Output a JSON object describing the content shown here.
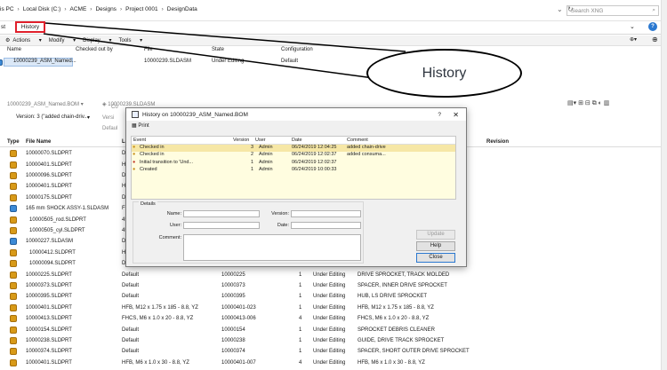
{
  "address": {
    "crumbs": [
      "is PC",
      "Local Disk (C:)",
      "ACME",
      "Designs",
      "Project 0001",
      "DesignData"
    ],
    "search_placeholder": "Search XNG"
  },
  "ribbon": {
    "left_stub": "st",
    "history_tab": "History"
  },
  "toolbar": {
    "actions": "Actions",
    "modify": "Modify",
    "display": "Display",
    "tools": "Tools"
  },
  "upper": {
    "headers": [
      "Name",
      "Checked out by",
      "File",
      "State",
      "Configuration"
    ],
    "row": {
      "name": "10000239_ASM_Named...",
      "checked_out_by": "",
      "file": "10000239.SLDASM",
      "state": "Under Editing",
      "configuration": "Default"
    }
  },
  "callout": {
    "text": "History"
  },
  "mid": {
    "tab1": "10000239_ASM_Named.BOM",
    "tab2": "10000239.SLDASM",
    "version_label": "Version: 3 (\"added chain-driv...",
    "versions_stub": "Versi",
    "default_stub": "Defaul",
    "con_stub": "Co"
  },
  "grid": {
    "headers": {
      "type": "Type",
      "file_name": "File Name",
      "revision": "Revision",
      "loc": "Loc"
    },
    "rows": [
      {
        "file": "10000070.SLDPRT",
        "config": "Def",
        "part": "",
        "ver": "",
        "state": "",
        "desc": ""
      },
      {
        "file": "10000401.SLDPRT",
        "config": "HFB",
        "part": "",
        "ver": "",
        "state": "",
        "desc": ""
      },
      {
        "file": "10000096.SLDPRT",
        "config": "Def",
        "part": "",
        "ver": "",
        "state": "",
        "desc": ""
      },
      {
        "file": "10000401.SLDPRT",
        "config": "HFB",
        "part": "",
        "ver": "",
        "state": "",
        "desc": ""
      },
      {
        "file": "10000175.SLDPRT",
        "config": "Def",
        "part": "",
        "ver": "",
        "state": "",
        "desc": ""
      },
      {
        "file": "165 mm SHOCK ASSY-1.SLDASM",
        "config": "Fre",
        "part": "",
        "ver": "",
        "state": "",
        "desc": "",
        "asm": true
      },
      {
        "file": "10000505_rod.SLDPRT",
        "config": "45n",
        "part": "",
        "ver": "",
        "state": "",
        "desc": ""
      },
      {
        "file": "10000505_cyl.SLDPRT",
        "config": "45n",
        "part": "",
        "ver": "",
        "state": "",
        "desc": ""
      },
      {
        "file": "10000227.SLDASM",
        "config": "Def",
        "part": "",
        "ver": "",
        "state": "",
        "desc": "",
        "asm": true
      },
      {
        "file": "10000412.SLDPRT",
        "config": "HEX",
        "part": "",
        "ver": "",
        "state": "",
        "desc": ""
      },
      {
        "file": "10000094.SLDPRT",
        "config": "Def",
        "part": "",
        "ver": "",
        "state": "",
        "desc": ""
      },
      {
        "file": "10000225.SLDPRT",
        "config": "Default",
        "part": "10000225",
        "ver": "1",
        "state": "Under Editing",
        "desc": "DRIVE SPROCKET, TRACK MOLDED"
      },
      {
        "file": "10000373.SLDPRT",
        "config": "Default",
        "part": "10000373",
        "ver": "1",
        "state": "Under Editing",
        "desc": "SPACER, INNER DRIVE SPROCKET"
      },
      {
        "file": "10000395.SLDPRT",
        "config": "Default",
        "part": "10000395",
        "ver": "1",
        "state": "Under Editing",
        "desc": "HUB, LS DRIVE SPROCKET"
      },
      {
        "file": "10000401.SLDPRT",
        "config": "HFB, M12 x 1.75 x 185 - 8.8, YZ",
        "part": "10000401-023",
        "ver": "1",
        "state": "Under Editing",
        "desc": "HFB, M12 x 1.75 x 185 - 8.8, YZ"
      },
      {
        "file": "10000413.SLDPRT",
        "config": "FHCS, M6 x 1.0 x 20 - 8.8, YZ",
        "part": "10000413-006",
        "ver": "4",
        "state": "Under Editing",
        "desc": "FHCS, M6 x 1.0 x 20 - 8.8, YZ"
      },
      {
        "file": "10000154.SLDPRT",
        "config": "Default",
        "part": "10000154",
        "ver": "1",
        "state": "Under Editing",
        "desc": "SPROCKET DEBRIS CLEANER"
      },
      {
        "file": "10000238.SLDPRT",
        "config": "Default",
        "part": "10000238",
        "ver": "1",
        "state": "Under Editing",
        "desc": "GUIDE, DRIVE TRACK SPROCKET"
      },
      {
        "file": "10000374.SLDPRT",
        "config": "Default",
        "part": "10000374",
        "ver": "1",
        "state": "Under Editing",
        "desc": "SPACER, SHORT OUTER DRIVE SPROCKET"
      },
      {
        "file": "10000401.SLDPRT",
        "config": "HFB, M6 x 1.0 x 30 - 8.8, YZ",
        "part": "10000401-007",
        "ver": "4",
        "state": "Under Editing",
        "desc": "HFB, M6 x 1.0 x 30 - 8.8, YZ"
      }
    ]
  },
  "dialog": {
    "title": "History on 10000239_ASM_Named.BOM",
    "help_glyph": "?",
    "close_glyph": "✕",
    "print": "Print",
    "headers": {
      "event": "Event",
      "version": "Version",
      "user": "User",
      "date": "Date",
      "comment": "Comment"
    },
    "events": [
      {
        "event": "Checked in",
        "version": "3",
        "user": "Admin",
        "date": "06/24/2019 12:04:25",
        "comment": "added chain-drive"
      },
      {
        "event": "Checked in",
        "version": "2",
        "user": "Admin",
        "date": "06/24/2019 12:02:37",
        "comment": "added consuma..."
      },
      {
        "event": "Initial transition to 'Und...",
        "version": "1",
        "user": "Admin",
        "date": "06/24/2019 12:02:37",
        "comment": ""
      },
      {
        "event": "Created",
        "version": "1",
        "user": "Admin",
        "date": "06/24/2019 10:00:33",
        "comment": ""
      }
    ],
    "details": "Details",
    "name_label": "Name:",
    "version_label": "Version:",
    "user_label": "User:",
    "date_label": "Date:",
    "comment_label": "Comment:",
    "update": "Update",
    "help": "Help",
    "close": "Close"
  },
  "colors": {
    "highlight": "#e0202c",
    "selection": "#f6e7a6",
    "event_bg": "#fffde0"
  }
}
